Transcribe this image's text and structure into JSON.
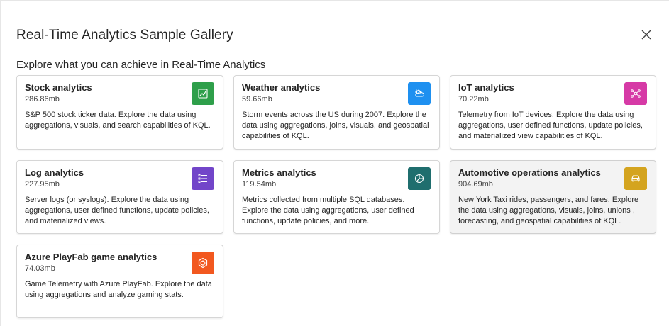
{
  "dialog": {
    "title": "Real-Time Analytics Sample Gallery",
    "subtitle": "Explore what you can achieve in Real-Time Analytics",
    "close_icon": "close-icon"
  },
  "cards": [
    {
      "name": "Stock analytics",
      "size": "286.86mb",
      "description": "S&P 500 stock ticker data. Explore the data using aggregations, visuals, and search capabilities of KQL.",
      "icon": "line-chart-icon",
      "color": "#2e9f4a"
    },
    {
      "name": "Weather analytics",
      "size": "59.66mb",
      "description": "Storm events across the US during 2007. Explore the data using aggregations, joins, visuals, and geospatial capabilities of KQL.",
      "icon": "weather-icon",
      "color": "#1e90f0"
    },
    {
      "name": "IoT analytics",
      "size": "70.22mb",
      "description": "Telemetry from IoT devices. Explore the data using aggregations, user defined functions, update policies, and materialized view capabilities of KQL.",
      "icon": "iot-network-icon",
      "color": "#d63aa6"
    },
    {
      "name": "Log analytics",
      "size": "227.95mb",
      "description": "Server logs (or syslogs). Explore the data using aggregations, user defined functions, update policies, and materialized views.",
      "icon": "list-icon",
      "color": "#7245c9"
    },
    {
      "name": "Metrics analytics",
      "size": "119.54mb",
      "description": "Metrics collected from multiple SQL databases. Explore the data using aggregations, user defined functions, update policies, and more.",
      "icon": "pie-chart-icon",
      "color": "#1f6e6e"
    },
    {
      "name": "Automotive operations analytics",
      "size": "904.69mb",
      "description": "New York Taxi rides, passengers, and fares. Explore the data using aggregations, visuals, joins, unions , forecasting, and geospatial capabilities of KQL.",
      "icon": "car-icon",
      "color": "#d4a41f"
    },
    {
      "name": "Azure PlayFab game analytics",
      "size": "74.03mb",
      "description": "Game Telemetry with Azure PlayFab. Explore the data using aggregations and analyze gaming stats.",
      "icon": "playfab-icon",
      "color": "#f2581f"
    }
  ]
}
